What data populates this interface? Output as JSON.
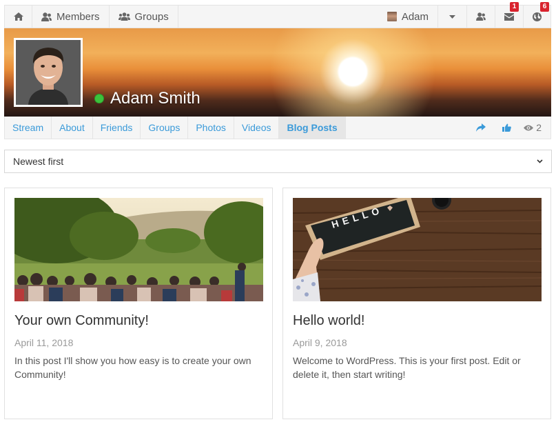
{
  "topnav": {
    "members_label": "Members",
    "groups_label": "Groups",
    "user_name": "Adam",
    "messages_count": "1",
    "notifications_count": "6"
  },
  "profile": {
    "name": "Adam Smith",
    "status": "online"
  },
  "tabs": [
    {
      "label": "Stream"
    },
    {
      "label": "About"
    },
    {
      "label": "Friends"
    },
    {
      "label": "Groups"
    },
    {
      "label": "Photos"
    },
    {
      "label": "Videos"
    },
    {
      "label": "Blog Posts",
      "active": true
    }
  ],
  "views_count": "2",
  "sort": {
    "selected": "Newest first"
  },
  "posts": [
    {
      "title": "Your own Community!",
      "date": "April 11, 2018",
      "excerpt": "In this post I'll show you how easy is to create your own Community!"
    },
    {
      "title": "Hello world!",
      "date": "April 9, 2018",
      "excerpt": "Welcome to WordPress. This is your first post. Edit or delete it, then start writing!",
      "image_text": "HELLO"
    }
  ],
  "colors": {
    "link": "#3a9ad9",
    "online": "#3cc23c",
    "badge": "#d9232e"
  }
}
